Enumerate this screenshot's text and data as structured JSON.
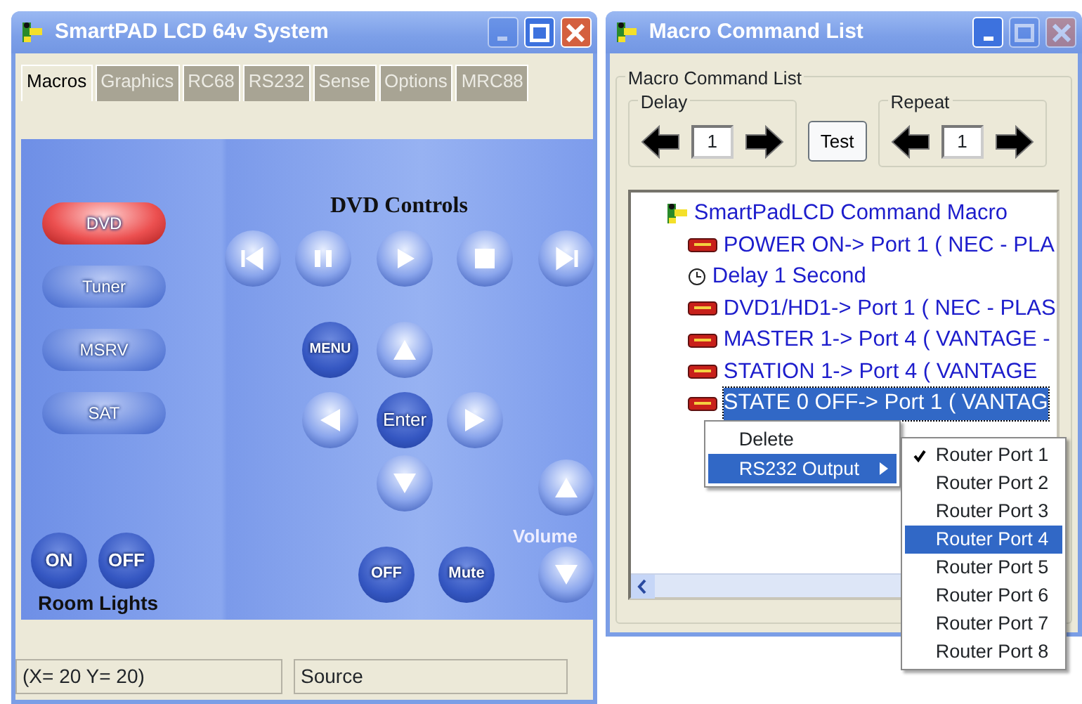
{
  "main_window": {
    "title": "SmartPAD LCD 64v System",
    "title_buttons": [
      {
        "kind": "minimize",
        "disabled": true
      },
      {
        "kind": "maximize",
        "disabled": false
      },
      {
        "kind": "close",
        "disabled": false
      }
    ],
    "tabs": [
      {
        "label": "Macros",
        "selected": true
      },
      {
        "label": "Graphics",
        "selected": false
      },
      {
        "label": "RC68",
        "selected": false
      },
      {
        "label": "RS232",
        "selected": false
      },
      {
        "label": "Sense",
        "selected": false
      },
      {
        "label": "Options",
        "selected": false
      },
      {
        "label": "MRC88",
        "selected": false
      }
    ],
    "remote": {
      "source_buttons": [
        {
          "label": "DVD",
          "selected": true
        },
        {
          "label": "Tuner",
          "selected": false
        },
        {
          "label": "MSRV",
          "selected": false
        },
        {
          "label": "SAT",
          "selected": false
        }
      ],
      "section_title": "DVD Controls",
      "menu_button": "MENU",
      "enter_button": "Enter",
      "off_button": "OFF",
      "mute_button": "Mute",
      "volume_label": "Volume",
      "room_lights": {
        "buttons": [
          "ON",
          "OFF"
        ],
        "label": "Room Lights"
      }
    },
    "status_bar": [
      "(X= 20 Y= 20)",
      "Source"
    ]
  },
  "macro_window": {
    "title": "Macro Command List",
    "title_buttons": [
      {
        "kind": "minimize",
        "disabled": false
      },
      {
        "kind": "maximize",
        "disabled": true
      },
      {
        "kind": "close",
        "disabled": true
      }
    ],
    "group_title": "Macro Command List",
    "delay": {
      "label": "Delay",
      "value": "1"
    },
    "test_button": "Test",
    "repeat": {
      "label": "Repeat",
      "value": "1"
    },
    "tree": {
      "root": "SmartPadLCD Command Macro",
      "children": [
        {
          "label": "POWER ON-> Port 1 ( NEC - PLA",
          "kind": "command",
          "selected": false
        },
        {
          "label": "Delay 1 Second",
          "kind": "delay",
          "selected": false
        },
        {
          "label": "DVD1/HD1-> Port 1 ( NEC - PLAS",
          "kind": "command",
          "selected": false
        },
        {
          "label": "MASTER 1-> Port 4 ( VANTAGE -",
          "kind": "command",
          "selected": false
        },
        {
          "label": "STATION 1-> Port 4 ( VANTAGE",
          "kind": "command",
          "selected": false
        },
        {
          "label": "STATE 0 OFF-> Port 1 ( VANTAG",
          "kind": "command",
          "selected": true
        }
      ]
    },
    "context_menu": [
      {
        "label": "Delete",
        "selected": false,
        "submenu": false
      },
      {
        "label": "RS232 Output",
        "selected": true,
        "submenu": true
      }
    ],
    "submenu": [
      {
        "label": "Router Port 1",
        "checked": true,
        "selected": false
      },
      {
        "label": "Router Port 2",
        "checked": false,
        "selected": false
      },
      {
        "label": "Router Port 3",
        "checked": false,
        "selected": false
      },
      {
        "label": "Router Port 4",
        "checked": false,
        "selected": true
      },
      {
        "label": "Router Port 5",
        "checked": false,
        "selected": false
      },
      {
        "label": "Router Port 6",
        "checked": false,
        "selected": false
      },
      {
        "label": "Router Port 7",
        "checked": false,
        "selected": false
      },
      {
        "label": "Router Port 8",
        "checked": false,
        "selected": false
      }
    ]
  }
}
